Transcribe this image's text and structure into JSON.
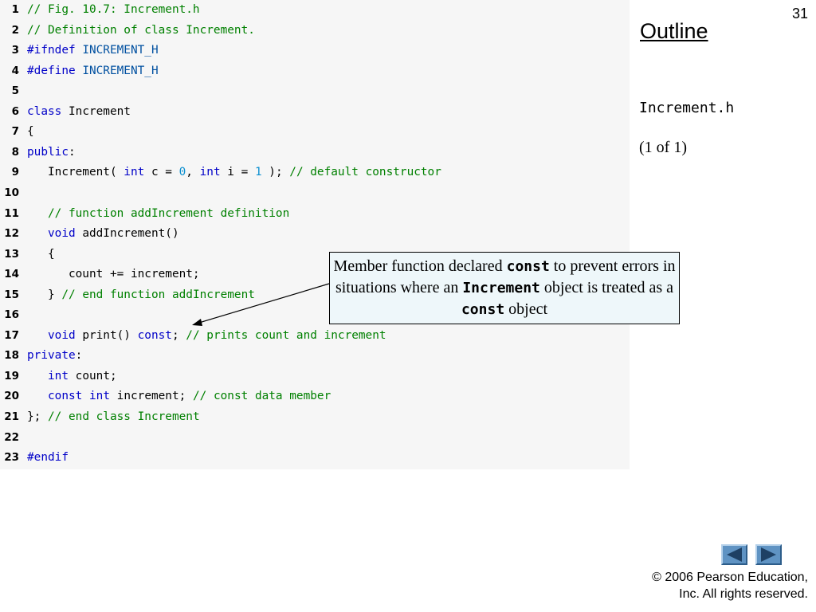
{
  "slide": {
    "number": "31",
    "outline_label": "Outline",
    "file_label": "Increment.h",
    "page_label": "(1 of 1)"
  },
  "code_lines": [
    {
      "n": "1",
      "tokens": [
        {
          "t": "// Fig. 10.7: Increment.h",
          "k": "comment"
        }
      ]
    },
    {
      "n": "2",
      "tokens": [
        {
          "t": "// Definition of class Increment.",
          "k": "comment"
        }
      ]
    },
    {
      "n": "3",
      "tokens": [
        {
          "t": "#ifndef",
          "k": "keyword"
        },
        {
          "t": " INCREMENT_H",
          "k": "macro"
        }
      ]
    },
    {
      "n": "4",
      "tokens": [
        {
          "t": "#define",
          "k": "keyword"
        },
        {
          "t": " INCREMENT_H",
          "k": "macro"
        }
      ]
    },
    {
      "n": "5",
      "tokens": []
    },
    {
      "n": "6",
      "tokens": [
        {
          "t": "class",
          "k": "keyword"
        },
        {
          "t": " Increment",
          "k": "plain"
        }
      ]
    },
    {
      "n": "7",
      "tokens": [
        {
          "t": "{",
          "k": "plain"
        }
      ]
    },
    {
      "n": "8",
      "tokens": [
        {
          "t": "public",
          "k": "keyword"
        },
        {
          "t": ":",
          "k": "plain"
        }
      ]
    },
    {
      "n": "9",
      "tokens": [
        {
          "t": "   Increment( ",
          "k": "plain"
        },
        {
          "t": "int",
          "k": "keyword"
        },
        {
          "t": " c = ",
          "k": "plain"
        },
        {
          "t": "0",
          "k": "number"
        },
        {
          "t": ", ",
          "k": "plain"
        },
        {
          "t": "int",
          "k": "keyword"
        },
        {
          "t": " i = ",
          "k": "plain"
        },
        {
          "t": "1",
          "k": "number"
        },
        {
          "t": " ); ",
          "k": "plain"
        },
        {
          "t": "// default constructor",
          "k": "comment"
        }
      ]
    },
    {
      "n": "10",
      "tokens": []
    },
    {
      "n": "11",
      "tokens": [
        {
          "t": "   // function addIncrement definition",
          "k": "comment"
        }
      ]
    },
    {
      "n": "12",
      "tokens": [
        {
          "t": "   ",
          "k": "plain"
        },
        {
          "t": "void",
          "k": "keyword"
        },
        {
          "t": " addIncrement()",
          "k": "plain"
        }
      ]
    },
    {
      "n": "13",
      "tokens": [
        {
          "t": "   {",
          "k": "plain"
        }
      ]
    },
    {
      "n": "14",
      "tokens": [
        {
          "t": "      count += increment;",
          "k": "plain"
        }
      ]
    },
    {
      "n": "15",
      "tokens": [
        {
          "t": "   } ",
          "k": "plain"
        },
        {
          "t": "// end function addIncrement",
          "k": "comment"
        }
      ]
    },
    {
      "n": "16",
      "tokens": []
    },
    {
      "n": "17",
      "tokens": [
        {
          "t": "   ",
          "k": "plain"
        },
        {
          "t": "void",
          "k": "keyword"
        },
        {
          "t": " print() ",
          "k": "plain"
        },
        {
          "t": "const",
          "k": "keyword"
        },
        {
          "t": "; ",
          "k": "plain"
        },
        {
          "t": "// prints count and increment",
          "k": "comment"
        }
      ]
    },
    {
      "n": "18",
      "tokens": [
        {
          "t": "private",
          "k": "keyword"
        },
        {
          "t": ":",
          "k": "plain"
        }
      ]
    },
    {
      "n": "19",
      "tokens": [
        {
          "t": "   ",
          "k": "plain"
        },
        {
          "t": "int",
          "k": "keyword"
        },
        {
          "t": " count;",
          "k": "plain"
        }
      ]
    },
    {
      "n": "20",
      "tokens": [
        {
          "t": "   ",
          "k": "plain"
        },
        {
          "t": "const",
          "k": "keyword"
        },
        {
          "t": " ",
          "k": "plain"
        },
        {
          "t": "int",
          "k": "keyword"
        },
        {
          "t": " increment; ",
          "k": "plain"
        },
        {
          "t": "// const data member",
          "k": "comment"
        }
      ]
    },
    {
      "n": "21",
      "tokens": [
        {
          "t": "}; ",
          "k": "plain"
        },
        {
          "t": "// end class Increment",
          "k": "comment"
        }
      ]
    },
    {
      "n": "22",
      "tokens": []
    },
    {
      "n": "23",
      "tokens": [
        {
          "t": "#endif",
          "k": "keyword"
        }
      ]
    }
  ],
  "callout": {
    "part1": "Member function declared ",
    "code1": "const",
    "part2": " to prevent errors in situations where an ",
    "code2": "Increment",
    "part3": " object is treated as a ",
    "code3": "const",
    "part4": " object"
  },
  "nav": {
    "prev_icon": "left-triangle-icon",
    "next_icon": "right-triangle-icon"
  },
  "copyright": {
    "line1": "© 2006 Pearson Education,",
    "line2": "Inc.  All rights reserved."
  },
  "colors": {
    "comment": "#008000",
    "keyword": "#0000c8",
    "number": "#0b8fd0",
    "nav_button": "#5f93c3"
  }
}
